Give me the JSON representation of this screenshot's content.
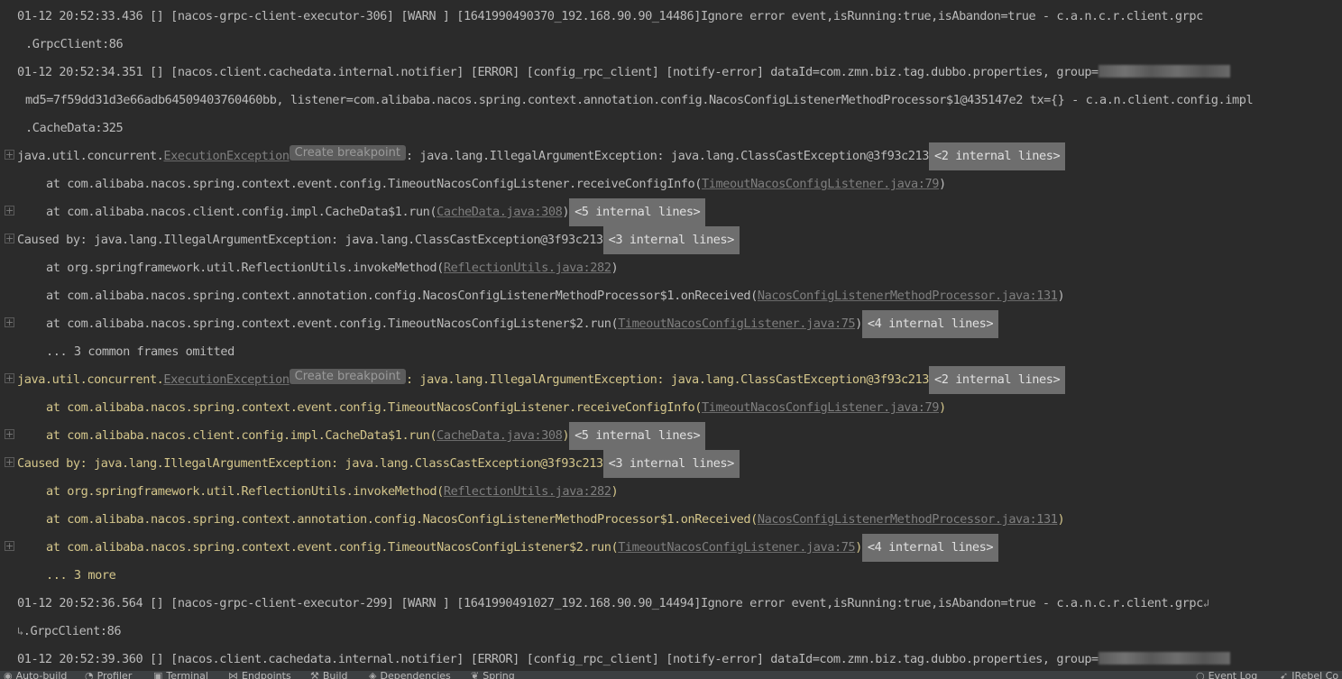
{
  "console": {
    "l1": "01-12 20:52:33.436 [] [nacos-grpc-client-executor-306] [WARN ] [1641990490370_192.168.90.90_14486]Ignore error event,isRunning:true,isAbandon=true - c.a.n.c.r.client.grpc",
    "l2": ".GrpcClient:86",
    "l3": "01-12 20:52:34.351 [] [nacos.client.cachedata.internal.notifier] [ERROR] [config_rpc_client] [notify-error] dataId=com.zmn.biz.tag.dubbo.properties, group=",
    "l4": "md5=7f59dd31d3e66adb64509403760460bb, listener=com.alibaba.nacos.spring.context.annotation.config.NacosConfigListenerMethodProcessor$1@435147e2 tx={} - c.a.n.client.config.impl",
    "l5": ".CacheData:325",
    "block1": {
      "exc_prefix": "java.util.concurrent.",
      "exc_name": "ExecutionException",
      "breakpoint": "Create breakpoint",
      "exc_rest": ": java.lang.IllegalArgumentException: java.lang.ClassCastException@3f93c213",
      "internal_2": "<2 internal lines>",
      "f1_pre": "at com.alibaba.nacos.spring.context.event.config.TimeoutNacosConfigListener.receiveConfigInfo(",
      "f1_link": "TimeoutNacosConfigListener.java:79",
      "f1_post": ")",
      "f2_pre": "at com.alibaba.nacos.client.config.impl.CacheData$1.run(",
      "f2_link": "CacheData.java:308",
      "f2_post": ")",
      "internal_5": "<5 internal lines>",
      "caused": "Caused by: java.lang.IllegalArgumentException: java.lang.ClassCastException@3f93c213",
      "internal_3": "<3 internal lines>",
      "f3_pre": "at org.springframework.util.ReflectionUtils.invokeMethod(",
      "f3_link": "ReflectionUtils.java:282",
      "f3_post": ")",
      "f4_pre": "at com.alibaba.nacos.spring.context.annotation.config.NacosConfigListenerMethodProcessor$1.onReceived(",
      "f4_link": "NacosConfigListenerMethodProcessor.java:131",
      "f4_post": ")",
      "f5_pre": "at com.alibaba.nacos.spring.context.event.config.TimeoutNacosConfigListener$2.run(",
      "f5_link": "TimeoutNacosConfigListener.java:75",
      "f5_post": ")",
      "internal_4": "<4 internal lines>",
      "omitted": "... 3 common frames omitted"
    },
    "block2": {
      "more": "... 3 more"
    },
    "l22": "01-12 20:52:36.564 [] [nacos-grpc-client-executor-299] [WARN ] [1641990491027_192.168.90.90_14494]Ignore error event,isRunning:true,isAbandon=true - c.a.n.c.r.client.grpc",
    "l23": ".GrpcClient:86",
    "l24": "01-12 20:52:39.360 [] [nacos.client.cachedata.internal.notifier] [ERROR] [config_rpc_client] [notify-error] dataId=com.zmn.biz.tag.dubbo.properties, group="
  },
  "statusbar": {
    "left": [
      {
        "icon": "auto-build-icon",
        "label": "Auto-build"
      },
      {
        "icon": "profiler-icon",
        "label": "Profiler"
      },
      {
        "icon": "terminal-icon",
        "label": "Terminal"
      },
      {
        "icon": "endpoints-icon",
        "label": "Endpoints"
      },
      {
        "icon": "build-icon",
        "label": "Build"
      },
      {
        "icon": "dependencies-icon",
        "label": "Dependencies"
      },
      {
        "icon": "spring-icon",
        "label": "Spring"
      }
    ],
    "right": [
      {
        "icon": "event-log-icon",
        "label": "Event Log"
      },
      {
        "icon": "jrebel-icon",
        "label": "JRebel Co"
      }
    ]
  },
  "colors": {
    "background": "#2b2b2b",
    "text": "#bbbbbb",
    "warn_text": "#d4c68b",
    "link": "#7f7f7f",
    "internal_badge": "#6e6e6e",
    "statusbar": "#3c3f41"
  }
}
